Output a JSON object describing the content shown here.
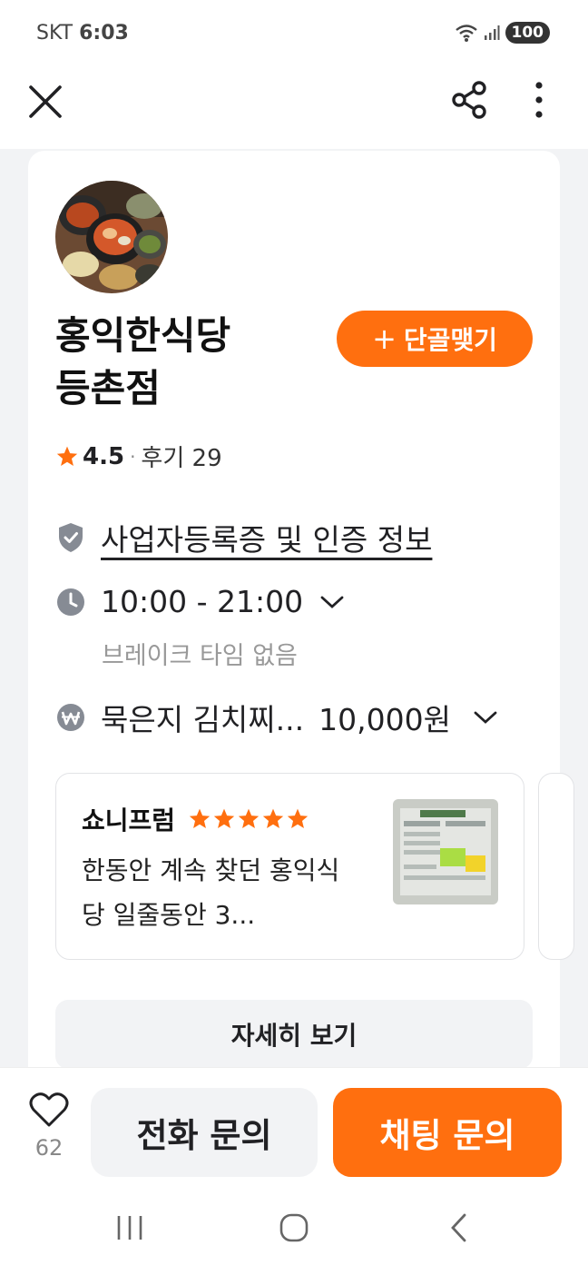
{
  "status_bar": {
    "carrier": "SKT",
    "time": "6:03",
    "battery": "100"
  },
  "store": {
    "name_line1": "홍익한식당",
    "name_line2": "등촌점",
    "regular_button": "단골맺기",
    "rating": "4.5",
    "review_label": "후기 29",
    "business_info": "사업자등록증 및 인증 정보",
    "hours": "10:00 - 21:00",
    "break_time": "브레이크 타임 없음",
    "menu_item": "묵은지 김치찌...",
    "menu_price": "10,000원"
  },
  "review": {
    "author": "쇼니프럼",
    "stars": 5,
    "text": "한동안 계속 찾던 홍익식당 일줄동안 3..."
  },
  "detail_button": "자세히 보기",
  "bottom": {
    "like_count": "62",
    "call_button": "전화 문의",
    "chat_button": "채팅 문의"
  },
  "colors": {
    "accent": "#ff6f0f",
    "icon_gray": "#868b94"
  }
}
